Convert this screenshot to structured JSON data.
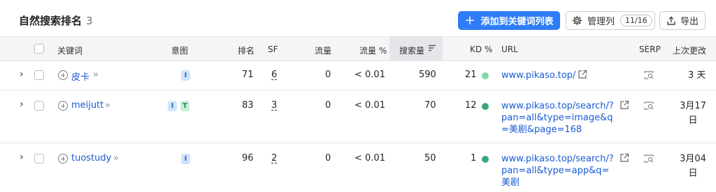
{
  "header": {
    "title": "自然搜索排名",
    "count": "3",
    "add_button": "添加到关键词列表",
    "manage_columns": "管理列",
    "columns_badge": "11/16",
    "export": "导出"
  },
  "columns": {
    "keyword": "关键词",
    "intent": "意图",
    "rank": "排名",
    "sf": "SF",
    "traffic": "流量",
    "traffic_pct": "流量 %",
    "volume": "搜索量",
    "kd": "KD %",
    "url": "URL",
    "serp": "SERP",
    "updated": "上次更改"
  },
  "colors": {
    "accent": "#2f7df6",
    "kd_easy": "#7ed9a8",
    "kd_medium": "#3aa676"
  },
  "rows": [
    {
      "keyword": "皮卡",
      "intents": [
        "I"
      ],
      "rank": "71",
      "sf": "6",
      "traffic": "0",
      "traffic_pct": "< 0.01",
      "volume": "590",
      "kd": "21",
      "url": "www.pikaso.top/",
      "updated_line1": "3 天",
      "updated_line2": ""
    },
    {
      "keyword": "meijutt",
      "intents": [
        "I",
        "T"
      ],
      "rank": "83",
      "sf": "3",
      "traffic": "0",
      "traffic_pct": "< 0.01",
      "volume": "70",
      "kd": "12",
      "url": "www.pikaso.top/search/?pan=all&type=image&q=美剧&page=168",
      "updated_line1": "3月17",
      "updated_line2": "日"
    },
    {
      "keyword": "tuostudy",
      "intents": [
        "I"
      ],
      "rank": "96",
      "sf": "2",
      "traffic": "0",
      "traffic_pct": "< 0.01",
      "volume": "50",
      "kd": "1",
      "url": "www.pikaso.top/search/?pan=all&type=app&q=美剧",
      "updated_line1": "3月04",
      "updated_line2": "日"
    }
  ]
}
